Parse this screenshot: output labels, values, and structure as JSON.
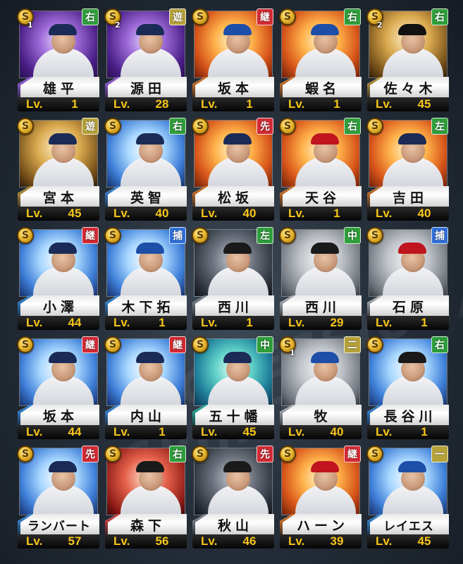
{
  "background_text": "PROFESSIONAL SPIRITS",
  "level_prefix": "Lv.",
  "coin_letter": "S",
  "position_colors": {
    "右": "#2f9e3b",
    "左": "#2f9e3b",
    "中": "#2f9e3b",
    "遊": "#b6a23a",
    "二": "#b6a23a",
    "一": "#b6a23a",
    "継": "#d22a35",
    "先": "#d22a35",
    "捕": "#2f6fd8"
  },
  "players": [
    {
      "name": "雄平",
      "level": "1",
      "position": "右",
      "rank": "1",
      "bg": "purple",
      "cap": "#1b2b57"
    },
    {
      "name": "源田",
      "level": "28",
      "position": "遊",
      "rank": "2",
      "bg": "purple",
      "cap": "#1b2b57"
    },
    {
      "name": "坂本",
      "level": "1",
      "position": "継",
      "rank": "",
      "bg": "fire",
      "cap": "#1e4fa8"
    },
    {
      "name": "蝦名",
      "level": "1",
      "position": "右",
      "rank": "",
      "bg": "fire",
      "cap": "#1e4fa8"
    },
    {
      "name": "佐々木",
      "level": "45",
      "position": "右",
      "rank": "2",
      "bg": "gold",
      "cap": "#111111"
    },
    {
      "name": "宮本",
      "level": "45",
      "position": "遊",
      "rank": "",
      "bg": "gold",
      "cap": "#1b2b57"
    },
    {
      "name": "英智",
      "level": "40",
      "position": "右",
      "rank": "",
      "bg": "blue",
      "cap": "#1b2b57"
    },
    {
      "name": "松坂",
      "level": "40",
      "position": "先",
      "rank": "",
      "bg": "fire",
      "cap": "#1b2b57"
    },
    {
      "name": "天谷",
      "level": "1",
      "position": "右",
      "rank": "",
      "bg": "fire",
      "cap": "#c0151f"
    },
    {
      "name": "吉田",
      "level": "40",
      "position": "左",
      "rank": "",
      "bg": "fire",
      "cap": "#1b2b57"
    },
    {
      "name": "小澤",
      "level": "44",
      "position": "継",
      "rank": "",
      "bg": "blue",
      "cap": "#1b2b57"
    },
    {
      "name": "木下拓",
      "level": "1",
      "position": "捕",
      "rank": "",
      "bg": "blue",
      "cap": "#1e4fa8"
    },
    {
      "name": "西川",
      "level": "1",
      "position": "左",
      "rank": "",
      "bg": "dark",
      "cap": "#1a1a1a"
    },
    {
      "name": "西川",
      "level": "29",
      "position": "中",
      "rank": "",
      "bg": "gray",
      "cap": "#1a1a1a"
    },
    {
      "name": "石原",
      "level": "1",
      "position": "捕",
      "rank": "",
      "bg": "gray",
      "cap": "#c0151f"
    },
    {
      "name": "坂本",
      "level": "44",
      "position": "継",
      "rank": "",
      "bg": "blue",
      "cap": "#1b2b57"
    },
    {
      "name": "内山",
      "level": "1",
      "position": "継",
      "rank": "",
      "bg": "blue",
      "cap": "#1b2b57"
    },
    {
      "name": "五十幡",
      "level": "45",
      "position": "中",
      "rank": "",
      "bg": "teal",
      "cap": "#1b2b57"
    },
    {
      "name": "牧",
      "level": "40",
      "position": "二",
      "rank": "1",
      "bg": "gray",
      "cap": "#1e4fa8"
    },
    {
      "name": "長谷川",
      "level": "1",
      "position": "右",
      "rank": "",
      "bg": "blue",
      "cap": "#1a1a1a"
    },
    {
      "name": "ランバート",
      "level": "57",
      "position": "先",
      "rank": "",
      "bg": "blue",
      "cap": "#1b2b57"
    },
    {
      "name": "森下",
      "level": "56",
      "position": "右",
      "rank": "",
      "bg": "red",
      "cap": "#1a1a1a"
    },
    {
      "name": "秋山",
      "level": "46",
      "position": "先",
      "rank": "",
      "bg": "dark",
      "cap": "#1a1a1a"
    },
    {
      "name": "ハーン",
      "level": "39",
      "position": "継",
      "rank": "",
      "bg": "fire",
      "cap": "#c0151f"
    },
    {
      "name": "レイエス",
      "level": "45",
      "position": "一",
      "rank": "",
      "bg": "blue",
      "cap": "#1e4fa8"
    }
  ]
}
